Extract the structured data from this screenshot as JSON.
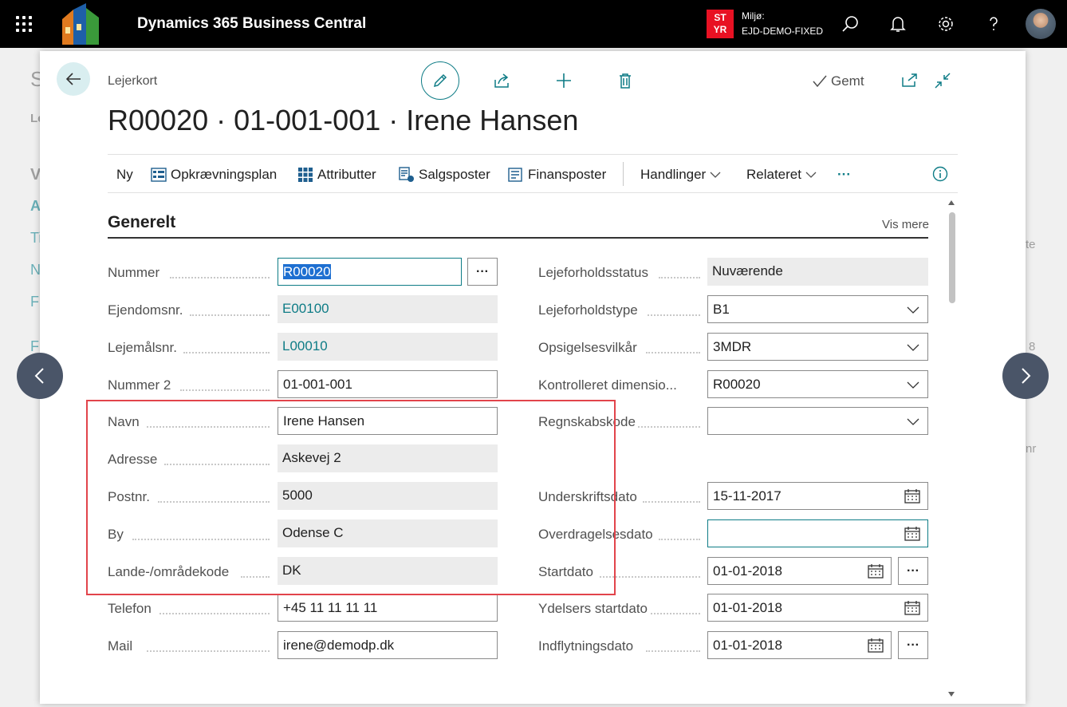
{
  "app": {
    "title": "Dynamics 365 Business Central"
  },
  "environment": {
    "badge_line1": "ST",
    "badge_line2": "YR",
    "label": "Miljø:",
    "name": "EJD-DEMO-FIXED"
  },
  "page": {
    "breadcrumb": "Lejerkort",
    "title": "R00020 · 01-001-001 · Irene Hansen",
    "saved_label": "Gemt"
  },
  "actions": [
    {
      "label": "Ny"
    },
    {
      "label": "Opkrævningsplan"
    },
    {
      "label": "Attributter"
    },
    {
      "label": "Salgsposter"
    },
    {
      "label": "Finansposter"
    },
    {
      "label": "Handlinger"
    },
    {
      "label": "Relateret"
    },
    {
      "label": "···"
    }
  ],
  "section": {
    "title": "Generelt",
    "more_label": "Vis mere"
  },
  "left_fields": [
    {
      "label": "Nummer",
      "value": "R00020"
    },
    {
      "label": "Ejendomsnr.",
      "value": "E00100"
    },
    {
      "label": "Lejemålsnr.",
      "value": "L00010"
    },
    {
      "label": "Nummer 2",
      "value": "01-001-001"
    },
    {
      "label": "Navn",
      "value": "Irene Hansen"
    },
    {
      "label": "Adresse",
      "value": "Askevej 2"
    },
    {
      "label": "Postnr.",
      "value": "5000"
    },
    {
      "label": "By",
      "value": "Odense C"
    },
    {
      "label": "Lande-/områdekode",
      "value": "DK"
    },
    {
      "label": "Telefon",
      "value": "+45 11 11 11 11"
    },
    {
      "label": "Mail",
      "value": "irene@demodp.dk"
    }
  ],
  "right_fields": [
    {
      "label": "Lejeforholdsstatus",
      "value": "Nuværende"
    },
    {
      "label": "Lejeforholdstype",
      "value": "B1"
    },
    {
      "label": "Opsigelsesvilkår",
      "value": "3MDR"
    },
    {
      "label": "Kontrolleret dimensio...",
      "value": "R00020"
    },
    {
      "label": "Regnskabskode",
      "value": ""
    },
    {
      "label": "Underskriftsdato",
      "value": "15-11-2017"
    },
    {
      "label": "Overdragelsesdato",
      "value": ""
    },
    {
      "label": "Startdato",
      "value": "01-01-2018"
    },
    {
      "label": "Ydelsers startdato",
      "value": "01-01-2018"
    },
    {
      "label": "Indflytningsdato",
      "value": "01-01-2018"
    }
  ],
  "ellipsis": "···",
  "background_page": {
    "l1": "S",
    "l2": "Le",
    "l3": "V",
    "l4": "A",
    "l5": "Ti",
    "l6": "N",
    "l7": "Fi",
    "l8": "Fi",
    "r1": "te",
    "r2": "8",
    "r3": "nr"
  },
  "colors": {
    "accent": "#0e7c86",
    "topbar": "#000000",
    "highlight": "#e2444b",
    "env_badge": "#e81123"
  }
}
